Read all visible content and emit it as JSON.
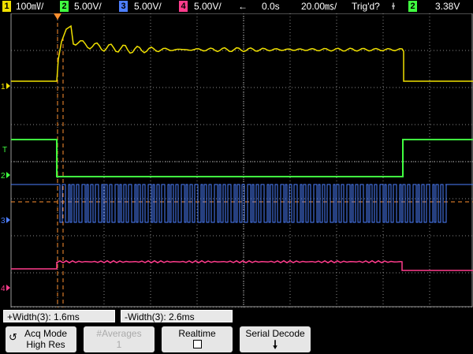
{
  "status_bar": {
    "ch1": {
      "num": "1",
      "scale": "100㎷/",
      "color": "#f0e000"
    },
    "ch2": {
      "num": "2",
      "scale": "5.00V/",
      "color": "#40ff40"
    },
    "ch3": {
      "num": "3",
      "scale": "5.00V/",
      "color": "#4d7fff"
    },
    "ch4": {
      "num": "4",
      "scale": "5.00V/",
      "color": "#ff3c8c"
    },
    "arrow": "←",
    "time_delay": "0.0s",
    "time_scale": "20.00㎳/",
    "trigger_status": "Trig'd?",
    "trigger_slope": "ɫ",
    "trigger_source": "2",
    "trigger_level": "3.38V"
  },
  "channel_markers": [
    "1",
    "2",
    "3",
    "4"
  ],
  "trigger_marker": "T",
  "measurements": [
    {
      "label": "+Width(3): 1.6ms"
    },
    {
      "label": "-Width(3): 2.6ms"
    }
  ],
  "softkeys": {
    "acq_mode": {
      "line1": "Acq Mode",
      "line2": "High Res"
    },
    "averages": {
      "line1": "#Averages",
      "line2": "1"
    },
    "realtime": {
      "line1": "Realtime"
    },
    "serial_decode": {
      "line1": "Serial Decode"
    }
  },
  "colors": {
    "ch1": "#f0e000",
    "ch2": "#40ff40",
    "ch3": "#4d7fff",
    "ch4": "#ff3c8c",
    "cursor": "#ff9030",
    "grid": "#8a8a8a"
  }
}
